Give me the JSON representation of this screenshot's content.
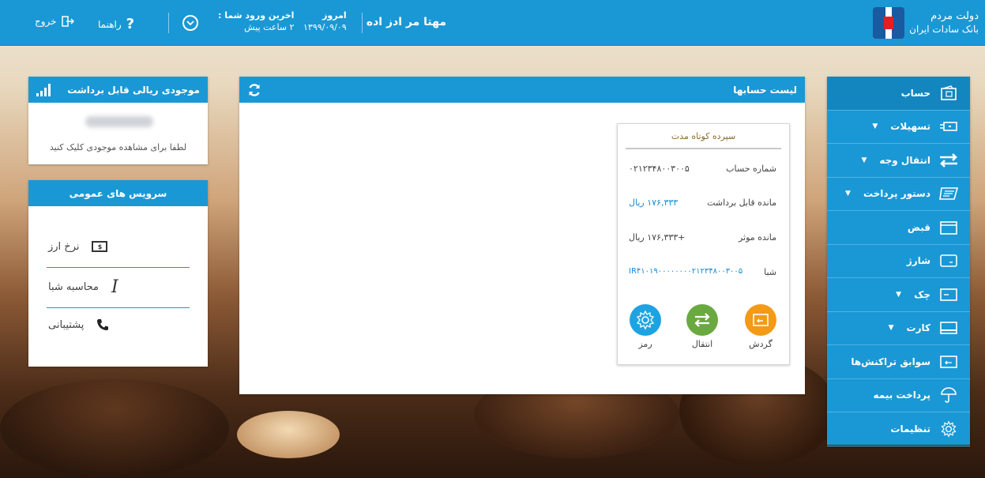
{
  "header": {
    "bank_name": "بانک سادات ایران",
    "bank_slogan": "دولت مردم",
    "user_name": "مهتا مر ادز اده",
    "today_label": "امروز",
    "today_date": "۱۳۹۹/۰۹/۰۹",
    "last_login_label": "اخرین ورود شما :",
    "last_login_value": "۲ ساعت پیش",
    "help_label": "راهنما",
    "exit_label": "خروج"
  },
  "sidebar": {
    "items": [
      {
        "label": "حساب",
        "icon": "wallet-icon",
        "active": true
      },
      {
        "label": "تسهیلات",
        "icon": "loan-icon",
        "dropdown": true
      },
      {
        "label": "انتقال وجه",
        "icon": "transfer-icon",
        "dropdown": true
      },
      {
        "label": "دستور پرداخت",
        "icon": "payment-order-icon",
        "dropdown": true
      },
      {
        "label": "قبض",
        "icon": "bill-icon"
      },
      {
        "label": "شارژ",
        "icon": "charge-icon"
      },
      {
        "label": "چک",
        "icon": "check-icon",
        "dropdown": true
      },
      {
        "label": "کارت",
        "icon": "card-icon",
        "dropdown": true
      },
      {
        "label": "سوابق تراکنش‌ها",
        "icon": "history-icon"
      },
      {
        "label": "پرداخت بیمه",
        "icon": "umbrella-icon"
      },
      {
        "label": "تنظیمات",
        "icon": "settings-icon"
      }
    ]
  },
  "accounts_panel": {
    "title": "لیست حسابها",
    "card": {
      "type": "سپرده کوتاه مدت",
      "account_number_label": "شماره حساب",
      "account_number": "۰۲۱۲۳۴۸۰۰۳۰۰۵",
      "withdrawable_label": "مانده قابل برداشت",
      "withdrawable_value": "۱۷۶,۳۳۳ ریال",
      "effective_label": "مانده موثر",
      "effective_value": "+۱۷۶,۳۳۳ ریال",
      "sheba_label": "شبا",
      "sheba_value": "IR۴۱۰۱۹۰۰۰۰۰۰۰۰۲۱۲۳۴۸۰۰۳۰۰۵",
      "actions": {
        "turnover": "گردش",
        "transfer": "انتقال",
        "password": "رمز"
      }
    }
  },
  "balance_panel": {
    "title": "موجودی ریالی قابل برداشت",
    "hint": "لطفا برای مشاهده موجودی کلیک کنید"
  },
  "services_panel": {
    "title": "سرویس های عمومی",
    "items": [
      {
        "label": "نرخ ارز",
        "icon": "currency-icon"
      },
      {
        "label": "محاسبه شبا",
        "icon": "cursor-icon"
      },
      {
        "label": "پشتیبانی",
        "icon": "phone-icon"
      }
    ]
  },
  "colors": {
    "primary": "#1a98d5",
    "turnover": "#f39a17",
    "transfer": "#6aa940",
    "password": "#1ea3e2"
  }
}
